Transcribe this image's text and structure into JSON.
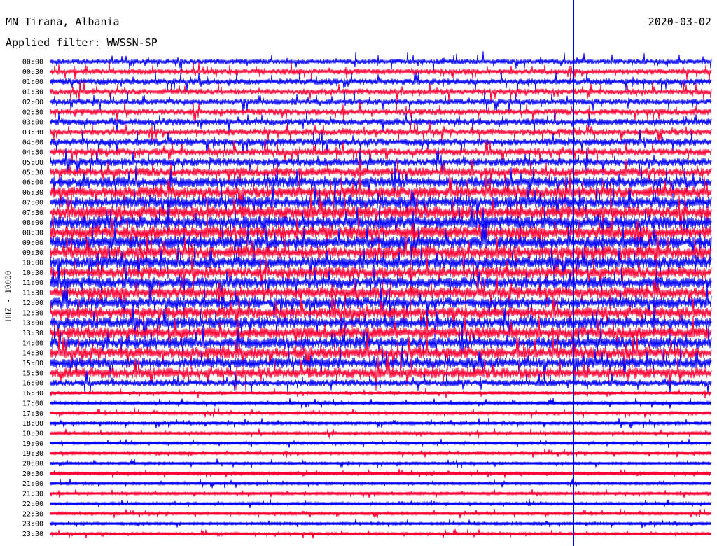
{
  "header": {
    "station": "MN Tirana, Albania",
    "date": "2020-03-02",
    "filter": "Applied filter: WWSSN-SP"
  },
  "chart_data": {
    "type": "line",
    "title": "MN Tirana, Albania",
    "ylabel": "HHZ - 10000",
    "row_labels": [
      "00:00",
      "00:30",
      "01:00",
      "01:30",
      "02:00",
      "02:30",
      "03:00",
      "03:30",
      "04:00",
      "04:30",
      "05:00",
      "05:30",
      "06:00",
      "06:30",
      "07:00",
      "07:30",
      "08:00",
      "08:30",
      "09:00",
      "09:30",
      "10:00",
      "10:30",
      "11:00",
      "11:30",
      "12:00",
      "12:30",
      "13:00",
      "13:30",
      "14:00",
      "14:30",
      "15:00",
      "15:30",
      "16:00",
      "16:30",
      "17:00",
      "17:30",
      "18:00",
      "18:30",
      "19:00",
      "19:30",
      "20:00",
      "20:30",
      "21:00",
      "21:30",
      "22:00",
      "22:30",
      "23:00",
      "23:30"
    ],
    "row_colors": [
      "#0000ff",
      "#ff0033"
    ],
    "amplitude_levels": [
      0.45,
      0.48,
      0.5,
      0.5,
      0.5,
      0.52,
      0.55,
      0.55,
      0.6,
      0.6,
      0.65,
      0.7,
      0.85,
      0.9,
      0.95,
      1.0,
      1.0,
      1.0,
      1.0,
      1.0,
      0.95,
      0.9,
      0.9,
      0.9,
      0.9,
      0.9,
      0.9,
      0.9,
      0.9,
      0.9,
      0.85,
      0.85,
      0.55,
      0.25,
      0.25,
      0.25,
      0.25,
      0.25,
      0.22,
      0.22,
      0.22,
      0.22,
      0.22,
      0.22,
      0.22,
      0.22,
      0.22,
      0.22
    ],
    "event_marker": {
      "row_start": "00:00",
      "row_end": "23:30",
      "color": "#0000ff"
    }
  }
}
